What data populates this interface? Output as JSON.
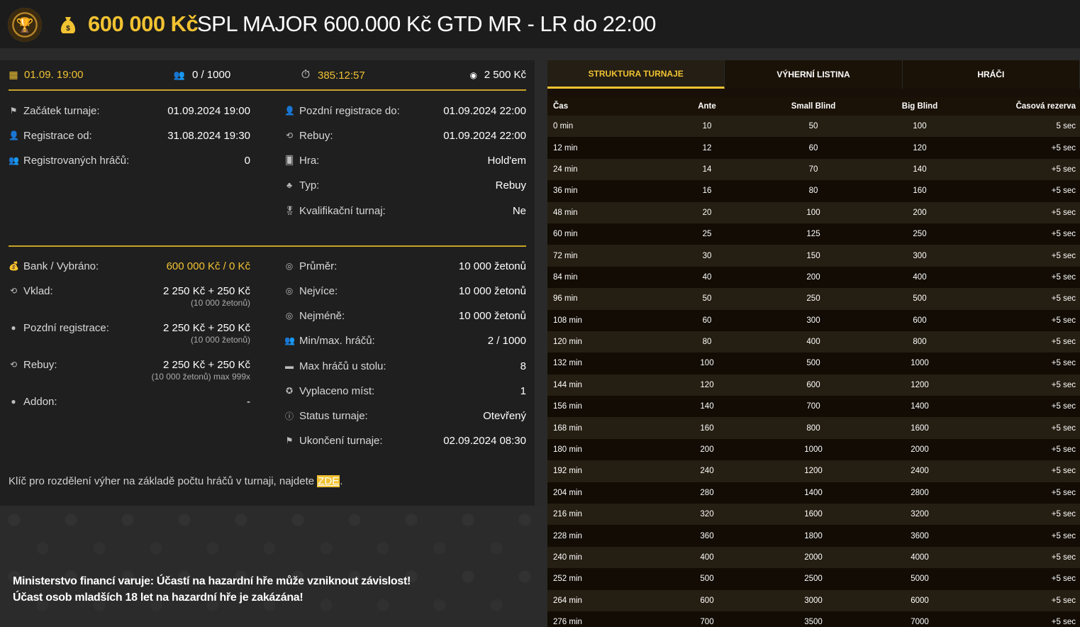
{
  "header": {
    "amount": "600 000 Kč",
    "title": "SPL MAJOR 600.000 Kč GTD MR - LR do 22:00"
  },
  "summary": {
    "date": "01.09. 19:00",
    "players": "0 / 1000",
    "timer": "385:12:57",
    "buyin": "2 500 Kč"
  },
  "info_left": [
    {
      "icon": "flag-icon",
      "label": "Začátek turnaje:",
      "value": "01.09.2024 19:00"
    },
    {
      "icon": "user-icon",
      "label": "Registrace od:",
      "value": "31.08.2024 19:30"
    },
    {
      "icon": "users-icon",
      "label": "Registrovaných hráčů:",
      "value": "0"
    }
  ],
  "info_right": [
    {
      "icon": "user-icon",
      "label": "Pozdní registrace do:",
      "value": "01.09.2024 22:00"
    },
    {
      "icon": "rebuy-icon",
      "label": "Rebuy:",
      "value": "01.09.2024 22:00"
    },
    {
      "icon": "cards-icon",
      "label": "Hra:",
      "value": "Hold'em"
    },
    {
      "icon": "type-icon",
      "label": "Typ:",
      "value": "Rebuy"
    },
    {
      "icon": "medal-icon",
      "label": "Kvalifikační turnaj:",
      "value": "Ne"
    }
  ],
  "money_left": [
    {
      "icon": "bag-icon",
      "label": "Bank / Vybráno:",
      "value": "600 000 Kč / 0 Kč",
      "note": ""
    },
    {
      "icon": "deposit-icon",
      "label": "Vklad:",
      "value": "2 250 Kč + 250 Kč",
      "note": "(10 000 žetonů)"
    },
    {
      "icon": "coin-icon",
      "label": "Pozdní registrace:",
      "value": "2 250 Kč + 250 Kč",
      "note": "(10 000 žetonů)"
    },
    {
      "icon": "rebuy-icon",
      "label": "Rebuy:",
      "value": "2 250 Kč + 250 Kč",
      "note": "(10 000 žetonů) max 999x"
    },
    {
      "icon": "coin-icon",
      "label": "Addon:",
      "value": "-",
      "note": ""
    }
  ],
  "money_right": [
    {
      "icon": "chip-icon",
      "label": "Průměr:",
      "value": "10 000 žetonů"
    },
    {
      "icon": "chip-icon",
      "label": "Nejvíce:",
      "value": "10 000 žetonů"
    },
    {
      "icon": "chip-icon",
      "label": "Nejméně:",
      "value": "10 000 žetonů"
    },
    {
      "icon": "users-icon",
      "label": "Min/max. hráčů:",
      "value": "2 / 1000"
    },
    {
      "icon": "table-icon",
      "label": "Max hráčů u stolu:",
      "value": "8"
    },
    {
      "icon": "award-icon",
      "label": "Vyplaceno míst:",
      "value": "1"
    },
    {
      "icon": "info-icon",
      "label": "Status turnaje:",
      "value": "Otevřený"
    },
    {
      "icon": "flag-icon",
      "label": "Ukončení turnaje:",
      "value": "02.09.2024 08:30"
    }
  ],
  "footer": {
    "text": "Klíč pro rozdělení výher na základě počtu hráčů v turnaji, najdete ",
    "link": "ZDE",
    "after": "."
  },
  "warning": {
    "line1": "Ministerstvo financí varuje: Účastí na hazardní hře může vzniknout závislost!",
    "line2": "Účast osob mladších 18 let na hazardní hře je zakázána!"
  },
  "tabs": [
    "STRUKTURA TURNAJE",
    "VÝHERNÍ LISTINA",
    "HRÁČI"
  ],
  "table": {
    "headers": [
      "Čas",
      "Ante",
      "Small Blind",
      "Big Blind",
      "Časová rezerva"
    ],
    "rows": [
      [
        "0 min",
        "10",
        "50",
        "100",
        "5 sec"
      ],
      [
        "12 min",
        "12",
        "60",
        "120",
        "+5 sec"
      ],
      [
        "24 min",
        "14",
        "70",
        "140",
        "+5 sec"
      ],
      [
        "36 min",
        "16",
        "80",
        "160",
        "+5 sec"
      ],
      [
        "48 min",
        "20",
        "100",
        "200",
        "+5 sec"
      ],
      [
        "60 min",
        "25",
        "125",
        "250",
        "+5 sec"
      ],
      [
        "72 min",
        "30",
        "150",
        "300",
        "+5 sec"
      ],
      [
        "84 min",
        "40",
        "200",
        "400",
        "+5 sec"
      ],
      [
        "96 min",
        "50",
        "250",
        "500",
        "+5 sec"
      ],
      [
        "108 min",
        "60",
        "300",
        "600",
        "+5 sec"
      ],
      [
        "120 min",
        "80",
        "400",
        "800",
        "+5 sec"
      ],
      [
        "132 min",
        "100",
        "500",
        "1000",
        "+5 sec"
      ],
      [
        "144 min",
        "120",
        "600",
        "1200",
        "+5 sec"
      ],
      [
        "156 min",
        "140",
        "700",
        "1400",
        "+5 sec"
      ],
      [
        "168 min",
        "160",
        "800",
        "1600",
        "+5 sec"
      ],
      [
        "180 min",
        "200",
        "1000",
        "2000",
        "+5 sec"
      ],
      [
        "192 min",
        "240",
        "1200",
        "2400",
        "+5 sec"
      ],
      [
        "204 min",
        "280",
        "1400",
        "2800",
        "+5 sec"
      ],
      [
        "216 min",
        "320",
        "1600",
        "3200",
        "+5 sec"
      ],
      [
        "228 min",
        "360",
        "1800",
        "3600",
        "+5 sec"
      ],
      [
        "240 min",
        "400",
        "2000",
        "4000",
        "+5 sec"
      ],
      [
        "252 min",
        "500",
        "2500",
        "5000",
        "+5 sec"
      ],
      [
        "264 min",
        "600",
        "3000",
        "6000",
        "+5 sec"
      ],
      [
        "276 min",
        "700",
        "3500",
        "7000",
        "+5 sec"
      ]
    ]
  }
}
